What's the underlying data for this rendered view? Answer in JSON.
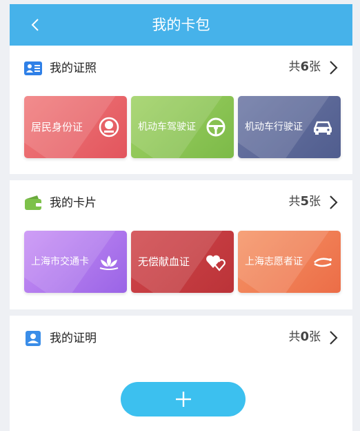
{
  "header": {
    "title": "我的卡包"
  },
  "sections": [
    {
      "title": "我的证照",
      "count": {
        "prefix": "共",
        "num": "6",
        "suffix": "张"
      },
      "cards": [
        {
          "label": "居民身份证",
          "icon": "emblem-icon"
        },
        {
          "label": "机动车驾驶证",
          "icon": "steering-wheel-icon"
        },
        {
          "label": "机动车行驶证",
          "icon": "car-icon"
        }
      ]
    },
    {
      "title": "我的卡片",
      "count": {
        "prefix": "共",
        "num": "5",
        "suffix": "张"
      },
      "cards": [
        {
          "label": "上海市交通卡",
          "icon": "lotus-icon"
        },
        {
          "label": "无偿献血证",
          "icon": "hearts-icon"
        },
        {
          "label": "上海志愿者证",
          "icon": "volunteer-hand-icon"
        }
      ]
    },
    {
      "title": "我的证明",
      "count": {
        "prefix": "共",
        "num": "0",
        "suffix": "张"
      }
    }
  ],
  "colors": {
    "header": "#46b2ea",
    "add_button": "#3cc0ef",
    "card_id": "#e96a6e",
    "card_license": "#8dc555",
    "card_vehicle": "#5e6999",
    "card_transit": "#b17aee",
    "card_blood": "#c63d42",
    "card_volunteer": "#f08156"
  },
  "add_button": {
    "icon": "plus-icon"
  }
}
